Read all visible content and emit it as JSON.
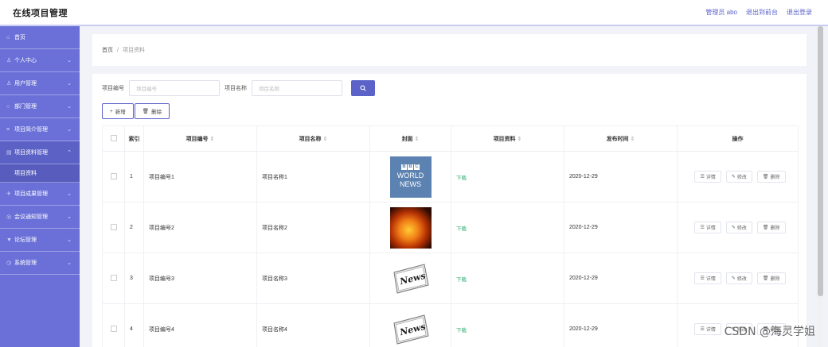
{
  "header": {
    "title": "在线项目管理",
    "links": [
      "管理员 abo",
      "退出到前台",
      "退出登录"
    ]
  },
  "sidebar": {
    "items": [
      {
        "label": "首页",
        "icon": "home-icon",
        "chevron": ""
      },
      {
        "label": "个人中心",
        "icon": "user-icon",
        "chevron": "⌄"
      },
      {
        "label": "用户管理",
        "icon": "users-icon",
        "chevron": "⌄"
      },
      {
        "label": "部门管理",
        "icon": "department-icon",
        "chevron": "⌄"
      },
      {
        "label": "项目简介管理",
        "icon": "list-icon",
        "chevron": "⌄"
      },
      {
        "label": "项目资料管理",
        "icon": "folder-icon",
        "chevron": "⌃",
        "open": true,
        "children": [
          "项目资料"
        ]
      },
      {
        "label": "项目成果管理",
        "icon": "send-icon",
        "chevron": "⌄"
      },
      {
        "label": "会议通知管理",
        "icon": "bell-icon",
        "chevron": "⌄"
      },
      {
        "label": "论坛管理",
        "icon": "forum-icon",
        "chevron": "⌄"
      },
      {
        "label": "系统管理",
        "icon": "settings-icon",
        "chevron": "⌄"
      }
    ]
  },
  "breadcrumb": {
    "home": "首页",
    "separator": "/",
    "current": "项目资料"
  },
  "search": {
    "field1_label": "项目编号",
    "field1_placeholder": "项目编号",
    "field2_label": "项目名称",
    "field2_placeholder": "项目名称",
    "button_icon": "search-icon"
  },
  "actions": {
    "add": "新增",
    "delete": "删除"
  },
  "table": {
    "columns": [
      "索引",
      "项目编号",
      "项目名称",
      "封面",
      "项目资料",
      "发布时间",
      "操作"
    ],
    "sort_glyph": "⇕",
    "rows": [
      {
        "index": "1",
        "code": "项目编号1",
        "name": "项目名称1",
        "cover": "bbc",
        "cover_text": [
          "WORLD",
          "NEWS"
        ],
        "material": "下载",
        "date": "2020-12-29"
      },
      {
        "index": "2",
        "code": "项目编号2",
        "name": "项目名称2",
        "cover": "fire",
        "material": "下载",
        "date": "2020-12-29"
      },
      {
        "index": "3",
        "code": "项目编号3",
        "name": "项目名称3",
        "cover": "news",
        "material": "下载",
        "date": "2020-12-29"
      },
      {
        "index": "4",
        "code": "项目编号4",
        "name": "项目名称4",
        "cover": "news",
        "material": "下载",
        "date": "2020-12-29"
      }
    ],
    "row_actions": [
      "详情",
      "修改",
      "删除"
    ]
  },
  "bbc_letters": [
    "B",
    "B",
    "C"
  ],
  "news_word": "News",
  "watermark": "CSDN @海灵学姐",
  "colors": {
    "sidebar": "#6a70d8",
    "accent": "#5b63c9",
    "download": "#2fae72"
  }
}
